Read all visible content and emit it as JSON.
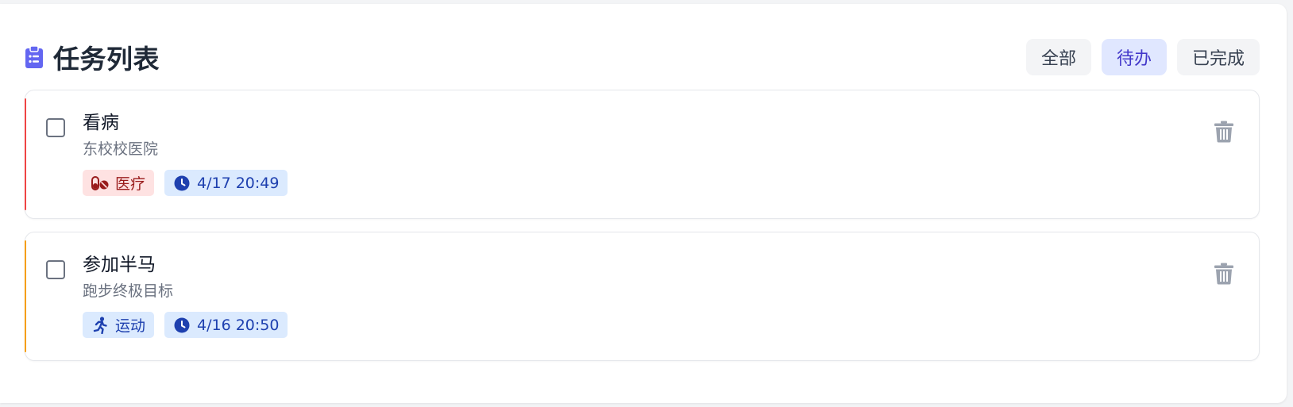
{
  "header": {
    "title": "任务列表",
    "title_icon": "clipboard-list-icon",
    "accent_color": "#6366f1"
  },
  "filters": {
    "all": "全部",
    "pending": "待办",
    "completed": "已完成",
    "active": "pending"
  },
  "tasks": [
    {
      "title": "看病",
      "description": "东校校医院",
      "checked": false,
      "accent_color": "#ef4444",
      "category": {
        "label": "医疗",
        "icon": "pills-icon",
        "bg_color": "#fee2e2",
        "text_color": "#991b1b"
      },
      "due": {
        "label": "4/17 20:49",
        "icon": "clock-icon",
        "bg_color": "#dbeafe",
        "text_color": "#1e40af"
      }
    },
    {
      "title": "参加半马",
      "description": "跑步终极目标",
      "checked": false,
      "accent_color": "#f59e0b",
      "category": {
        "label": "运动",
        "icon": "running-icon",
        "bg_color": "#dbeafe",
        "text_color": "#1e40af"
      },
      "due": {
        "label": "4/16 20:50",
        "icon": "clock-icon",
        "bg_color": "#dbeafe",
        "text_color": "#1e40af"
      }
    }
  ]
}
